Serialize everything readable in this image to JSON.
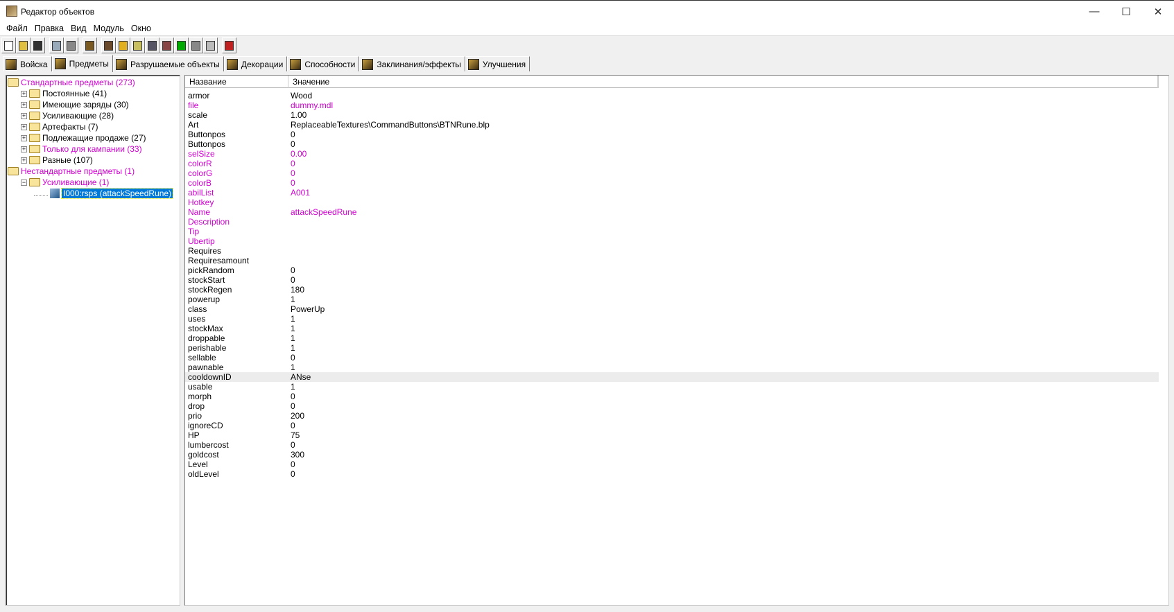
{
  "window": {
    "title": "Редактор объектов",
    "minimize": "—",
    "maximize": "☐",
    "close": "✕"
  },
  "menu": [
    "Файл",
    "Правка",
    "Вид",
    "Модуль",
    "Окно"
  ],
  "toolbar": [
    "new",
    "open",
    "save",
    "copy",
    "paste",
    "item-editor",
    "terrain",
    "text",
    "sound",
    "unit",
    "camera",
    "ai",
    "object",
    "import",
    "trigger"
  ],
  "tabs": [
    {
      "label": "Войска"
    },
    {
      "label": "Предметы",
      "active": true
    },
    {
      "label": "Разрушаемые объекты"
    },
    {
      "label": "Декорации"
    },
    {
      "label": "Способности"
    },
    {
      "label": "Заклинания/эффекты"
    },
    {
      "label": "Улучшения"
    }
  ],
  "tree": [
    {
      "label": "Стандартные предметы (273)",
      "level": 0,
      "magenta": true,
      "type": "folder-open"
    },
    {
      "label": "Постоянные (41)",
      "level": 1,
      "type": "folder",
      "pm": "+"
    },
    {
      "label": "Имеющие заряды (30)",
      "level": 1,
      "type": "folder",
      "pm": "+"
    },
    {
      "label": "Усиливающие (28)",
      "level": 1,
      "type": "folder",
      "pm": "+"
    },
    {
      "label": "Артефакты (7)",
      "level": 1,
      "type": "folder",
      "pm": "+"
    },
    {
      "label": "Подлежащие продаже (27)",
      "level": 1,
      "type": "folder",
      "pm": "+"
    },
    {
      "label": "Только для кампании (33)",
      "level": 1,
      "type": "folder",
      "pm": "+",
      "magenta": true
    },
    {
      "label": "Разные (107)",
      "level": 1,
      "type": "folder",
      "pm": "+"
    },
    {
      "label": "Нестандартные предметы (1)",
      "level": 0,
      "magenta": true,
      "type": "folder-open"
    },
    {
      "label": "Усиливающие (1)",
      "level": 1,
      "magenta": true,
      "type": "folder-open",
      "pm": "−"
    },
    {
      "label": "I000:rsps (attackSpeedRune)",
      "level": 2,
      "type": "item",
      "selected": true
    }
  ],
  "columns": {
    "name": "Название",
    "value": "Значение"
  },
  "colors": {
    "modified": "#d000d0",
    "selection": "#0078d7"
  },
  "fields": [
    [
      "armor",
      "Wood",
      0
    ],
    [
      "file",
      "dummy.mdl",
      1
    ],
    [
      "scale",
      "1.00",
      0
    ],
    [
      "Art",
      "ReplaceableTextures\\CommandButtons\\BTNRune.blp",
      0
    ],
    [
      "Buttonpos",
      "0",
      0
    ],
    [
      "Buttonpos",
      "0",
      0
    ],
    [
      "selSize",
      "0.00",
      1
    ],
    [
      "colorR",
      "0",
      1
    ],
    [
      "colorG",
      "0",
      1
    ],
    [
      "colorB",
      "0",
      1
    ],
    [
      "abilList",
      "A001",
      1
    ],
    [
      "Hotkey",
      "",
      1
    ],
    [
      "Name",
      "attackSpeedRune",
      1
    ],
    [
      "Description",
      "",
      1
    ],
    [
      "Tip",
      "",
      1
    ],
    [
      "Ubertip",
      "",
      1
    ],
    [
      "Requires",
      "",
      0
    ],
    [
      "Requiresamount",
      "",
      0
    ],
    [
      "pickRandom",
      "0",
      0
    ],
    [
      "stockStart",
      "0",
      0
    ],
    [
      "stockRegen",
      "180",
      0
    ],
    [
      "powerup",
      "1",
      0
    ],
    [
      "class",
      "PowerUp",
      0
    ],
    [
      "uses",
      "1",
      0
    ],
    [
      "stockMax",
      "1",
      0
    ],
    [
      "droppable",
      "1",
      0
    ],
    [
      "perishable",
      "1",
      0
    ],
    [
      "sellable",
      "0",
      0
    ],
    [
      "pawnable",
      "1",
      0
    ],
    [
      "cooldownID",
      "ANse",
      0,
      1
    ],
    [
      "usable",
      "1",
      0
    ],
    [
      "morph",
      "0",
      0
    ],
    [
      "drop",
      "0",
      0
    ],
    [
      "prio",
      "200",
      0
    ],
    [
      "ignoreCD",
      "0",
      0
    ],
    [
      "HP",
      "75",
      0
    ],
    [
      "lumbercost",
      "0",
      0
    ],
    [
      "goldcost",
      "300",
      0
    ],
    [
      "Level",
      "0",
      0
    ],
    [
      "oldLevel",
      "0",
      0
    ]
  ]
}
